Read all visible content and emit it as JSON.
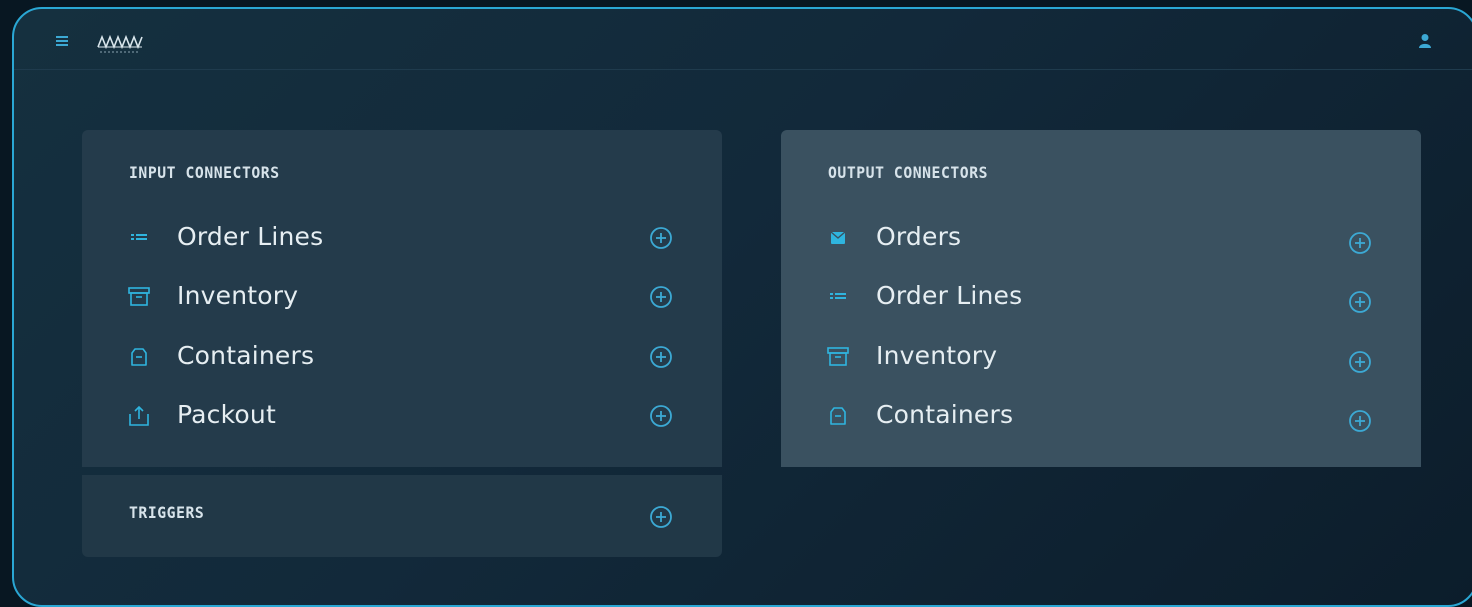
{
  "header": {
    "menu_icon": "hamburger-menu-icon",
    "logo_icon": "brand-logo",
    "user_icon": "user-icon"
  },
  "colors": {
    "accent": "#4fc3e8",
    "frame_border": "#2aa7d4",
    "input_panel": "#243b4b",
    "output_panel": "#3a5160",
    "text": "#e6eef2"
  },
  "input_connectors": {
    "title": "INPUT CONNECTORS",
    "items": [
      {
        "label": "Order Lines",
        "icon": "list-icon"
      },
      {
        "label": "Inventory",
        "icon": "archive-box-icon"
      },
      {
        "label": "Containers",
        "icon": "container-bag-icon"
      },
      {
        "label": "Packout",
        "icon": "upload-box-icon"
      }
    ]
  },
  "triggers": {
    "title": "TRIGGERS"
  },
  "output_connectors": {
    "title": "OUTPUT CONNECTORS",
    "items": [
      {
        "label": "Orders",
        "icon": "order-icon"
      },
      {
        "label": "Order Lines",
        "icon": "list-icon"
      },
      {
        "label": "Inventory",
        "icon": "archive-box-icon"
      },
      {
        "label": "Containers",
        "icon": "container-bag-icon"
      }
    ]
  }
}
